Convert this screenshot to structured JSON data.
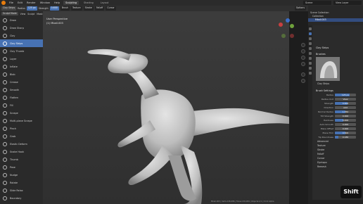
{
  "menubar": {
    "items": [
      "File",
      "Edit",
      "Render",
      "Window",
      "Help"
    ],
    "workspaces": [
      "Sculpting",
      "Shading",
      "Layout"
    ],
    "active_workspace": "Sculpting",
    "scene": "Scene",
    "view_layer": "View Layer"
  },
  "tool_header": {
    "brush_name": "Clay Strips",
    "radius_label": "Radius",
    "radius_value": "125 px",
    "strength_label": "Strength",
    "strength_value": "0.600",
    "menus": [
      "Brush",
      "Texture",
      "Stroke",
      "Falloff",
      "Cursor"
    ],
    "options": "Options"
  },
  "mode_header": {
    "mode": "Sculpt Mode",
    "menus": [
      "View",
      "Sculpt",
      "Mask",
      "Face Sets"
    ]
  },
  "toolbar": {
    "active_tool": "Clay Strips",
    "tools": [
      "Draw",
      "Draw Sharp",
      "Clay",
      "Clay Strips",
      "Clay Thumb",
      "Layer",
      "Inflate",
      "Blob",
      "Crease",
      "Smooth",
      "Flatten",
      "Fill",
      "Scrape",
      "Multi-plane Scrape",
      "Pinch",
      "Grab",
      "Elastic Deform",
      "Snake Hook",
      "Thumb",
      "Pose",
      "Nudge",
      "Rotate",
      "Slide Relax",
      "Boundary"
    ]
  },
  "viewport": {
    "view_name": "User Perspective",
    "object_name": "(1) Mball.003"
  },
  "outliner": {
    "title": "Scene Collection",
    "collection": "Collection",
    "object": "Mball.003"
  },
  "properties": {
    "tool_section": "Brushes",
    "brush_name": "Clay Strips",
    "brush_settings_title": "Brush Settings",
    "fields": [
      {
        "label": "Radius",
        "value": "125 px",
        "fill": 0.7
      },
      {
        "label": "Radius Unit",
        "value": "View",
        "fill": 0
      },
      {
        "label": "Strength",
        "value": "0.600",
        "fill": 0.6
      },
      {
        "label": "Direction",
        "value": "Add",
        "fill": 0
      },
      {
        "label": "Normal Radius",
        "value": "1.550",
        "fill": 0.5
      },
      {
        "label": "Tilt Strength",
        "value": "0.000",
        "fill": 0
      },
      {
        "label": "Hardness",
        "value": "0.400",
        "fill": 0.4
      },
      {
        "label": "Auto Smooth",
        "value": "0.000",
        "fill": 0
      },
      {
        "label": "Plane Offset",
        "value": "0.000",
        "fill": 0
      },
      {
        "label": "Plane Trim",
        "value": "0.500",
        "fill": 0.5
      },
      {
        "label": "Tip Roundness",
        "value": "0.180",
        "fill": 0.18
      }
    ],
    "subpanels": [
      "Advanced",
      "Texture",
      "Stroke",
      "Falloff",
      "Cursor",
      "Dyntopo",
      "Remesh"
    ]
  },
  "statusbar": {
    "stats": "Mball.003 | Verts:136,086 | Faces:136,084 | Objects:1/1 | 3.0.0 Alpha"
  },
  "key_overlay": "Shift",
  "colors": {
    "accent": "#4772b3",
    "blender_orange": "#e87d0d",
    "viewport_bg": "#3a3a3a"
  }
}
